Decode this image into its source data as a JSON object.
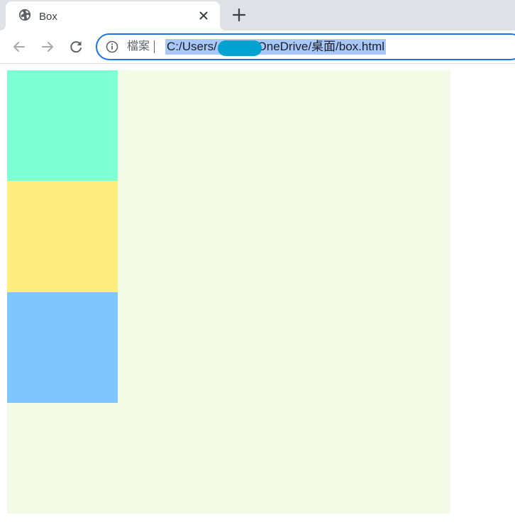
{
  "tab": {
    "title": "Box",
    "favicon": "globe-icon",
    "close_icon": "close-icon"
  },
  "toolbar": {
    "back_icon": "arrow-left-icon",
    "forward_icon": "arrow-right-icon",
    "reload_icon": "reload-icon",
    "new_tab_icon": "plus-icon"
  },
  "omnibox": {
    "info_icon": "info-icon",
    "security_label": "檔案",
    "url": "C:/Users/           /OneDrive/桌面/box.html",
    "focus_color": "#1a73e8",
    "selection_color": "#a8c7fa",
    "redaction_color": "#00a2cf"
  },
  "page": {
    "outer_box_color": "#f3fbe6",
    "boxes": [
      {
        "color": "#7fffd4"
      },
      {
        "color": "#ffee7f"
      },
      {
        "color": "#7fc6ff"
      }
    ]
  }
}
